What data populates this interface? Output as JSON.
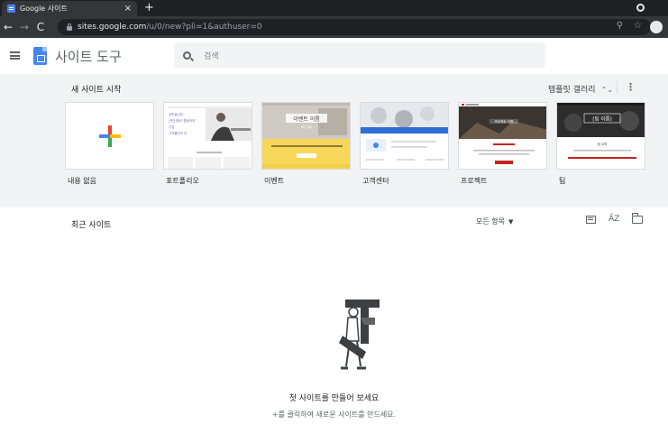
{
  "browser": {
    "tab_title": "Google 사이트",
    "tab_close": "×",
    "new_tab": "+",
    "url_host": "sites.google.com",
    "url_path": "/u/0/new?pli=1&authuser=0"
  },
  "app": {
    "title": "사이트 도구",
    "search_placeholder": "검색"
  },
  "templates": {
    "section_title": "새 사이트 시작",
    "gallery_button": "템플릿 갤러리",
    "items": [
      {
        "label": "내용 없음"
      },
      {
        "label": "포트폴리오",
        "thumb_text": [
          "유민솔니티",
          "|전단|에서 활동하여",
          "기업",
          "고객물건이 이"
        ]
      },
      {
        "label": "이벤트",
        "thumb_text": [
          "이벤트 이름",
          "행사 날짜",
          "지금 등록",
          "등록"
        ]
      },
      {
        "label": "고객센터"
      },
      {
        "label": "프로젝트",
        "thumb_text": [
          "프로젝트 이름"
        ]
      },
      {
        "label": "팀",
        "thumb_text": [
          "[팀 이름]",
          "팀 요약"
        ]
      }
    ]
  },
  "recent": {
    "section_title": "최근 사이트",
    "owner_filter": "모든 항목",
    "sort_label": "A͂Z"
  },
  "empty_state": {
    "title": "첫 사이트를 만들어 보세요",
    "subtitle": "+를 클릭하여 새로운 사이트를 만드세요."
  },
  "colors": {
    "chrome_dark": "#202124",
    "chrome_toolbar": "#35363a",
    "template_bg": "#f1f3f4",
    "sites_blue": "#4285f4",
    "event_yellow": "#f7d75a",
    "project_dark": "#3a3530",
    "team_dark": "#2d2d2d",
    "accent_red": "#c5221f"
  }
}
